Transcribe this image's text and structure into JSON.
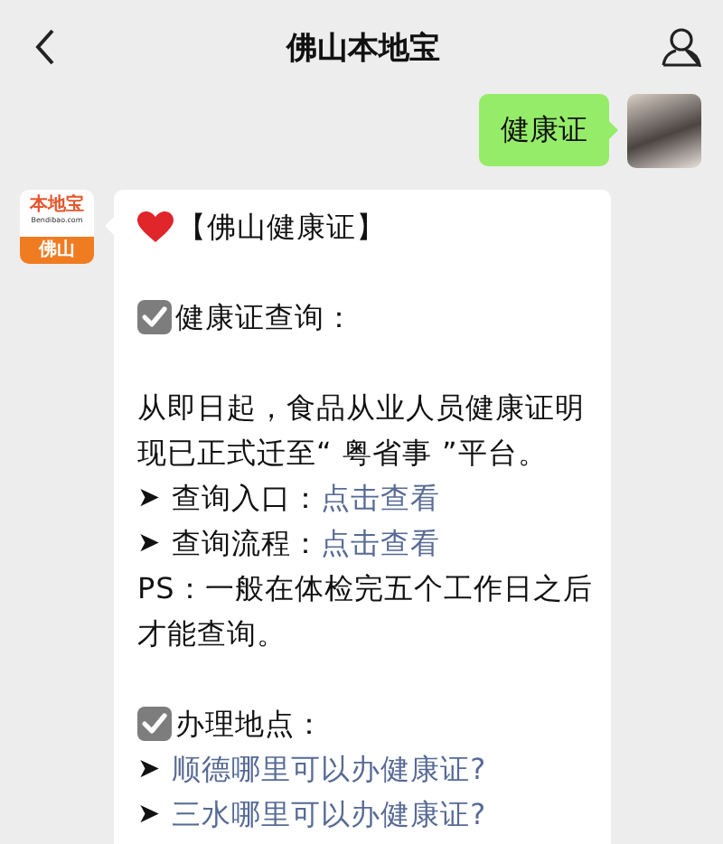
{
  "header": {
    "title": "佛山本地宝"
  },
  "messages": [
    {
      "kind": "outgoing",
      "text": "健康证"
    },
    {
      "kind": "incoming",
      "logo": {
        "brand": "本地宝",
        "domain": "Bendibao.com",
        "city": "佛山"
      },
      "blocks": [
        {
          "kind": "heart_heading",
          "text": "【佛山健康证】"
        },
        {
          "kind": "blank"
        },
        {
          "kind": "check_heading",
          "text": "健康证查询："
        },
        {
          "kind": "blank"
        },
        {
          "kind": "paragraph",
          "text": "从即日起，食品从业人员健康证明现已正式迁至“ 粤省事 ”平台。"
        },
        {
          "kind": "labeled_link",
          "arrow": "➤",
          "label": "查询入口：",
          "link": "点击查看"
        },
        {
          "kind": "labeled_link",
          "arrow": "➤",
          "label": "查询流程：",
          "link": "点击查看"
        },
        {
          "kind": "paragraph",
          "text": "PS：一般在体检完五个工作日之后才能查询。"
        },
        {
          "kind": "blank"
        },
        {
          "kind": "check_heading",
          "text": "办理地点："
        },
        {
          "kind": "arrow_link",
          "arrow": "➤",
          "link": "顺德哪里可以办健康证?"
        },
        {
          "kind": "arrow_link",
          "arrow": "➤",
          "link": "三水哪里可以办健康证?"
        }
      ]
    }
  ]
}
